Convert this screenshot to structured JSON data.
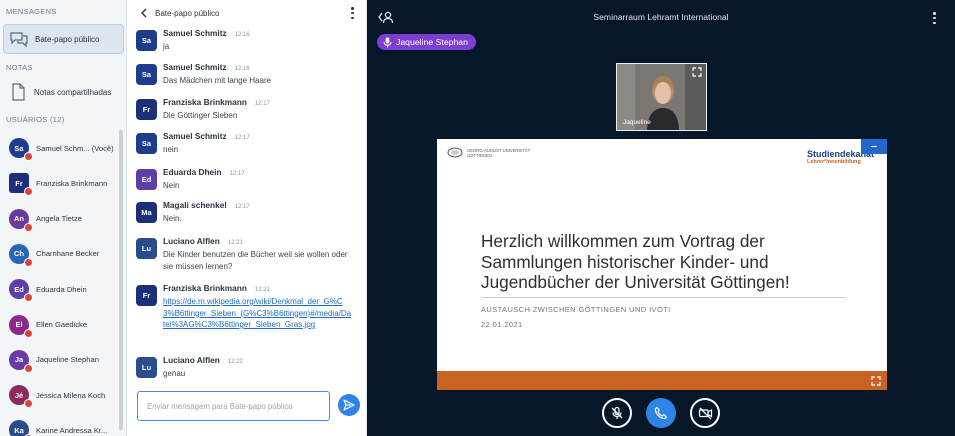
{
  "sidebar": {
    "messages_header": "MENSAGENS",
    "public_chat_label": "Bate-papo público",
    "notes_header": "NOTAS",
    "shared_notes_label": "Notas compartilhadas",
    "users_header": "USUÁRIOS (12)",
    "users": [
      {
        "initials": "Sa",
        "name": "Samuel Schm... (Você)",
        "color": "#1d3c8c",
        "square": false
      },
      {
        "initials": "Fr",
        "name": "Franziska Brinkmann",
        "color": "#1b2f7a",
        "square": true
      },
      {
        "initials": "An",
        "name": "Angela Tietze",
        "color": "#6a3c9a",
        "square": false
      },
      {
        "initials": "Ch",
        "name": "Charnhane Becker",
        "color": "#2568b8",
        "square": false
      },
      {
        "initials": "Ed",
        "name": "Eduarda Dhein",
        "color": "#5c3fa8",
        "square": false
      },
      {
        "initials": "El",
        "name": "Ellen Gaedicke",
        "color": "#8a2b8a",
        "square": false
      },
      {
        "initials": "Ja",
        "name": "Jaqueline Stephan",
        "color": "#6a3aa8",
        "square": false
      },
      {
        "initials": "Jé",
        "name": "Jéssica Milena Koch",
        "color": "#8c2a5a",
        "square": false
      },
      {
        "initials": "Ka",
        "name": "Karine Andressa Kr...",
        "color": "#2a4c8c",
        "square": false
      }
    ]
  },
  "chat": {
    "title": "Bate-papo público",
    "messages": [
      {
        "initials": "Sa",
        "color": "#1d3c8c",
        "name": "Samuel Schmitz",
        "time": "12:16",
        "text": "ja",
        "link": false
      },
      {
        "initials": "Sa",
        "color": "#1d3c8c",
        "name": "Samuel Schmitz",
        "time": "12:16",
        "text": "Das Mädchen mit lange Haare",
        "link": false
      },
      {
        "initials": "Fr",
        "color": "#1b2f7a",
        "name": "Franziska Brinkmann",
        "time": "12:17",
        "text": "Die Göttinger Sieben",
        "link": false
      },
      {
        "initials": "Sa",
        "color": "#1d3c8c",
        "name": "Samuel Schmitz",
        "time": "12:17",
        "text": "nein",
        "link": false
      },
      {
        "initials": "Ed",
        "color": "#5c3fa8",
        "name": "Eduarda Dhein",
        "time": "12:17",
        "text": "Nein",
        "link": false
      },
      {
        "initials": "Ma",
        "color": "#1b2f7a",
        "name": "Magali schenkel",
        "time": "12:17",
        "text": "Nein.",
        "link": false
      },
      {
        "initials": "Lu",
        "color": "#2a4c8c",
        "name": "Luciano Alflen",
        "time": "12:21",
        "text": "Die Kinder benutzen die Bücher weil sie wollen oder sie müssen lernen?",
        "link": false
      },
      {
        "initials": "Fr",
        "color": "#1b2f7a",
        "name": "Franziska Brinkmann",
        "time": "12:21",
        "text": "https://de.m.wikipedia.org/wiki/Denkmal_der_G%C3%B6ttinger_Sieben_(G%C3%B6ttingen)#/media/Datei%3AG%C3%B6ttinger_Sieben_Gras.jpg",
        "link": true
      },
      {
        "initials": "Lu",
        "color": "#2a4c8c",
        "name": "Luciano Alflen",
        "time": "12:22",
        "text": "genau",
        "link": false
      }
    ],
    "input_placeholder": "Enviar mensagem para Bate-papo público"
  },
  "main": {
    "room_title": "Seminarraum Lehramt International",
    "talker_name": "Jaqueline Stephan",
    "webcam_label": "Jaqueline",
    "slide": {
      "university": "GEORG-AUGUST-UNIVERSITÄT GÖTTINGEN",
      "dept_title": "Studiendekanat",
      "dept_sub": "Lehrer*innenbildung",
      "title": "Herzlich willkommen zum Vortrag der Sammlungen historischer Kinder- und Jugendbücher der Universität Göttingen!",
      "subtitle": "AUSTAUSCH ZWISCHEN GÖTTINGEN UND IVOTI",
      "date": "22.01.2021"
    }
  },
  "colors": {
    "accent": "#2d84e6",
    "talker": "#7c3ed1",
    "mute": "#d9433d",
    "slide_bar": "#c96324",
    "slide_btn": "#2268c9"
  },
  "icons": [
    "chat-icon",
    "notes-icon",
    "back-chevron-icon",
    "more-options-icon",
    "send-icon",
    "user-list-toggle-icon",
    "microphone-icon",
    "fullscreen-icon",
    "muted-microphone-icon",
    "phone-icon",
    "camera-off-icon"
  ]
}
